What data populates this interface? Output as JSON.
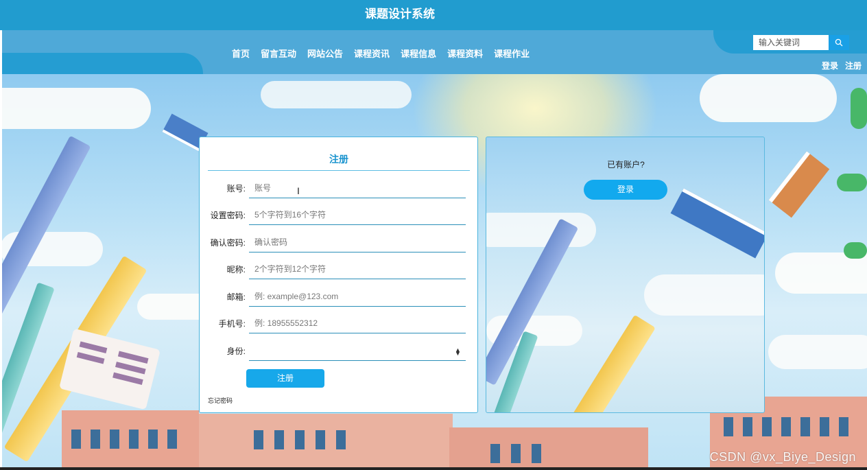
{
  "header": {
    "site_title": "课题设计系统"
  },
  "nav": {
    "items": [
      {
        "label": "首页"
      },
      {
        "label": "留言互动"
      },
      {
        "label": "网站公告"
      },
      {
        "label": "课程资讯"
      },
      {
        "label": "课程信息"
      },
      {
        "label": "课程资料"
      },
      {
        "label": "课程作业"
      }
    ]
  },
  "search": {
    "placeholder": "输入关键词",
    "icon": "search-icon"
  },
  "auth": {
    "login_label": "登录",
    "register_label": "注册"
  },
  "register_form": {
    "title": "注册",
    "fields": [
      {
        "label": "账号:",
        "placeholder": "账号"
      },
      {
        "label": "设置密码:",
        "placeholder": "5个字符到16个字符"
      },
      {
        "label": "确认密码:",
        "placeholder": "确认密码"
      },
      {
        "label": "昵称:",
        "placeholder": "2个字符到12个字符"
      },
      {
        "label": "邮箱:",
        "placeholder": "例: example@123.com"
      },
      {
        "label": "手机号:",
        "placeholder": "例: 18955552312"
      },
      {
        "label": "身份:",
        "value": ""
      }
    ],
    "submit_label": "注册",
    "forgot_label": "忘记密码"
  },
  "login_panel": {
    "prompt": "已有账户?",
    "login_button": "登录"
  },
  "watermark": "CSDN @vx_Biye_Design",
  "colors": {
    "header": "#219ccf",
    "nav": "#4fa9d8",
    "accent": "#17a8ea",
    "title": "#1c95cf"
  }
}
